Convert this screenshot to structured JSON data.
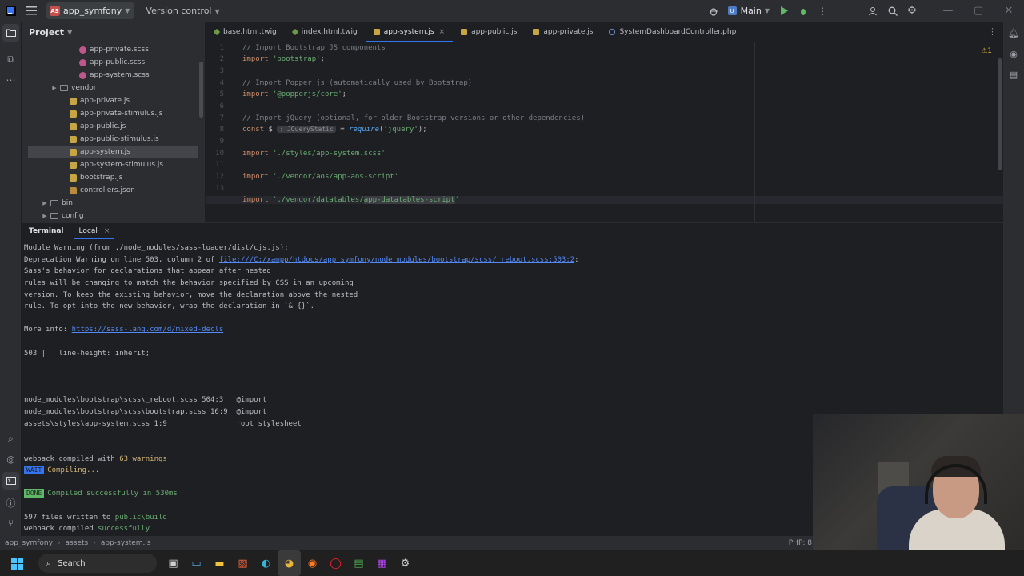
{
  "titlebar": {
    "project_badge": "AS",
    "project_name": "app_symfony",
    "version_control": "Version control",
    "branch": "Main"
  },
  "project_panel": {
    "title": "Project",
    "items": [
      {
        "label": "app-private.scss",
        "type": "scss",
        "indent": 5
      },
      {
        "label": "app-public.scss",
        "type": "scss",
        "indent": 5
      },
      {
        "label": "app-system.scss",
        "type": "scss",
        "indent": 5
      },
      {
        "label": "vendor",
        "type": "folder",
        "indent": 3,
        "expander": "▶"
      },
      {
        "label": "app-private.js",
        "type": "js",
        "indent": 4
      },
      {
        "label": "app-private-stimulus.js",
        "type": "js",
        "indent": 4
      },
      {
        "label": "app-public.js",
        "type": "js",
        "indent": 4
      },
      {
        "label": "app-public-stimulus.js",
        "type": "js",
        "indent": 4
      },
      {
        "label": "app-system.js",
        "type": "js",
        "indent": 4,
        "selected": true
      },
      {
        "label": "app-system-stimulus.js",
        "type": "js",
        "indent": 4
      },
      {
        "label": "bootstrap.js",
        "type": "js",
        "indent": 4
      },
      {
        "label": "controllers.json",
        "type": "json",
        "indent": 4
      },
      {
        "label": "bin",
        "type": "folder",
        "indent": 2,
        "expander": "▶"
      },
      {
        "label": "config",
        "type": "folder",
        "indent": 2,
        "expander": "▶"
      }
    ]
  },
  "editor": {
    "tabs": [
      {
        "label": "base.html.twig",
        "icon": "twig"
      },
      {
        "label": "index.html.twig",
        "icon": "twig"
      },
      {
        "label": "app-system.js",
        "icon": "js",
        "active": true,
        "close": "×"
      },
      {
        "label": "app-public.js",
        "icon": "js"
      },
      {
        "label": "app-private.js",
        "icon": "js"
      },
      {
        "label": "SystemDashboardController.php",
        "icon": "php"
      }
    ],
    "warning_count": "⚠1",
    "line_numbers": [
      "1",
      "2",
      "3",
      "4",
      "5",
      "6",
      "7",
      "8",
      "9",
      "10",
      "11",
      "12",
      "13",
      "14"
    ],
    "code": {
      "l1": "// Import Bootstrap JS components",
      "l2_kw": "import",
      "l2_str": "'bootstrap'",
      "l2_end": ";",
      "l4": "// Import Popper.js (automatically used by Bootstrap)",
      "l5_kw": "import",
      "l5_str": "'@popperjs/core'",
      "l5_end": ";",
      "l7": "// Import jQuery (optional, for older Bootstrap versions or other dependencies)",
      "l8_kw": "const",
      "l8_var": " $ ",
      "l8_hint": ": JQueryStatic",
      "l8_eq": " = ",
      "l8_fn": "require",
      "l8_open": "(",
      "l8_str": "'jquery'",
      "l8_end": ");",
      "l10_kw": "import",
      "l10_str": "'./styles/app-system.scss'",
      "l12_kw": "import",
      "l12_str": "'./vendor/aos/app-aos-script'",
      "l14_kw": "import",
      "l14_str_a": "'./vendor/datatables/",
      "l14_str_b": "app-datatables-script",
      "l14_str_c": "'"
    }
  },
  "terminal": {
    "title": "Terminal",
    "tab": "Local",
    "tab_close": "×",
    "lines": {
      "t1": "Module Warning (from ./node_modules/sass-loader/dist/cjs.js):",
      "t2a": "Deprecation Warning on line 503, column 2 of ",
      "t2link": "file:///C:/xampp/htdocs/app_symfony/node_modules/bootstrap/scss/_reboot.scss:503:2",
      "t2b": ":",
      "t3": "Sass's behavior for declarations that appear after nested",
      "t4": "rules will be changing to match the behavior specified by CSS in an upcoming",
      "t5": "version. To keep the existing behavior, move the declaration above the nested",
      "t6": "rule. To opt into the new behavior, wrap the declaration in `& {}`.",
      "t8a": "More info: ",
      "t8link": "https://sass-lang.com/d/mixed-decls",
      "t10": "503 |   line-height: inherit;",
      "t14": "node_modules\\bootstrap\\scss\\_reboot.scss 504:3   @import",
      "t15": "node_modules\\bootstrap\\scss\\bootstrap.scss 16:9  @import",
      "t16": "assets\\styles\\app-system.scss 1:9                root stylesheet",
      "t19a": "webpack compiled with ",
      "t19b": "63 warnings",
      "t20badge": "WAIT",
      "t20": "Compiling...",
      "t22badge": "DONE",
      "t22": "Compiled successfully in 530ms",
      "t24a": "597 files written to ",
      "t24b": "public\\build",
      "t25a": "webpack compiled ",
      "t25b": "successfully"
    }
  },
  "statusbar": {
    "crumbs": [
      "app_symfony",
      "assets",
      "app-system.js"
    ],
    "right": "PHP: 8"
  },
  "taskbar": {
    "search": "Search"
  },
  "colors": {
    "accent": "#3574f0",
    "warning": "#e0b341",
    "success": "#5fb865"
  }
}
